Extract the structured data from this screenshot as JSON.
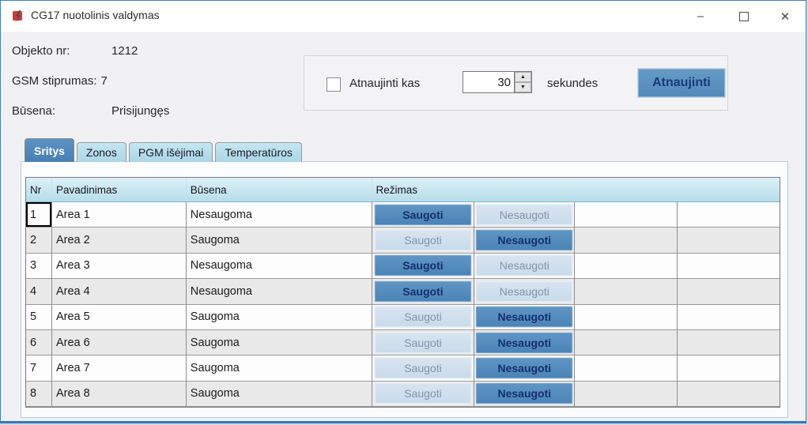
{
  "window": {
    "title": "CG17 nuotolinis valdymas",
    "minimize_glyph": "–",
    "close_glyph": "✕"
  },
  "info": {
    "object_label": "Objekto nr:",
    "object_value": "1212",
    "gsm_label": "GSM stiprumas:",
    "gsm_value": "7",
    "status_label": "Būsena:",
    "status_value": "Prisijungęs"
  },
  "refresh": {
    "checkbox_checked": false,
    "checkbox_label": "Atnaujinti kas",
    "interval_value": "30",
    "unit_label": "sekundes",
    "button_label": "Atnaujinti"
  },
  "tabs": [
    {
      "label": "Sritys",
      "selected": true
    },
    {
      "label": "Zonos",
      "selected": false
    },
    {
      "label": "PGM išėjimai",
      "selected": false
    },
    {
      "label": "Temperatūros",
      "selected": false
    }
  ],
  "table": {
    "headers": [
      "Nr",
      "Pavadinimas",
      "Būsena",
      "Režimas"
    ],
    "arm_label": "Saugoti",
    "disarm_label": "Nesaugoti",
    "rows": [
      {
        "nr": "1",
        "name": "Area 1",
        "state": "Nesaugoma",
        "armed": false
      },
      {
        "nr": "2",
        "name": "Area 2",
        "state": "Saugoma",
        "armed": true
      },
      {
        "nr": "3",
        "name": "Area 3",
        "state": "Nesaugoma",
        "armed": false
      },
      {
        "nr": "4",
        "name": "Area 4",
        "state": "Nesaugoma",
        "armed": false
      },
      {
        "nr": "5",
        "name": "Area 5",
        "state": "Saugoma",
        "armed": true
      },
      {
        "nr": "6",
        "name": "Area 6",
        "state": "Saugoma",
        "armed": true
      },
      {
        "nr": "7",
        "name": "Area 7",
        "state": "Saugoma",
        "armed": true
      },
      {
        "nr": "8",
        "name": "Area 8",
        "state": "Saugoma",
        "armed": true
      }
    ]
  },
  "colors": {
    "accent_blue": "#4c86ba",
    "light_button": "#cfdeed",
    "tab_unselected": "#b0d8e8",
    "header_blue": "#c4e4ef",
    "window_border": "#3f7fbf",
    "alt_row": "#e9e9e9"
  }
}
